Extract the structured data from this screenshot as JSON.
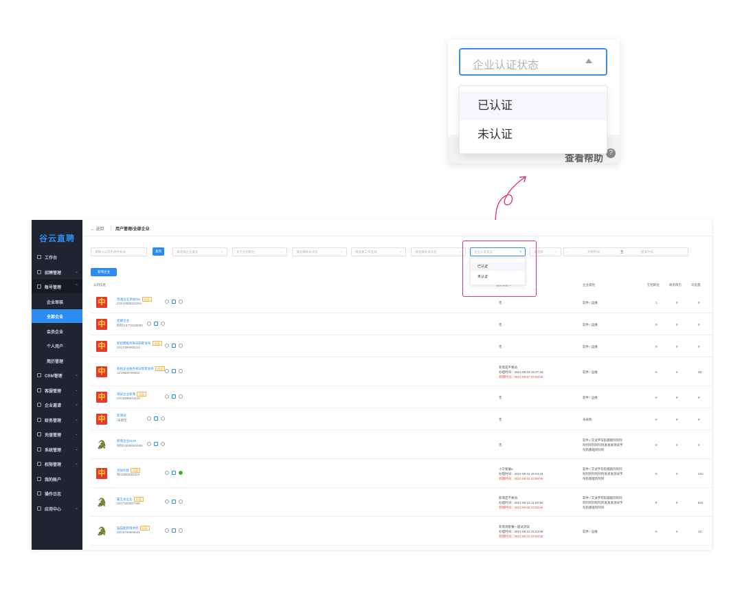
{
  "zoom": {
    "select_placeholder": "企业认证状态",
    "options": [
      "已认证",
      "未认证"
    ],
    "footer_text": "查看帮助"
  },
  "app": {
    "logo": "谷云直聘",
    "breadcrumb": {
      "back": "返回",
      "path": "用户管理/全部企业"
    },
    "sidebar": [
      {
        "label": "工作台",
        "type": "top",
        "chev": ""
      },
      {
        "label": "招聘管理",
        "type": "top",
        "chev": "⌄"
      },
      {
        "label": "账号管理",
        "type": "group",
        "chev": "⌃"
      },
      {
        "label": "企业审核",
        "type": "sub",
        "chev": ""
      },
      {
        "label": "全部企业",
        "type": "active",
        "chev": ""
      },
      {
        "label": "会员企业",
        "type": "sub",
        "chev": ""
      },
      {
        "label": "个人用户",
        "type": "sub",
        "chev": ""
      },
      {
        "label": "简历管理",
        "type": "sub",
        "chev": ""
      },
      {
        "label": "CRM管理",
        "type": "top",
        "chev": "⌄"
      },
      {
        "label": "客服管理",
        "type": "top",
        "chev": "⌄"
      },
      {
        "label": "企业邀请",
        "type": "top",
        "chev": "⌄"
      },
      {
        "label": "财务管理",
        "type": "top",
        "chev": "⌄"
      },
      {
        "label": "充值管理",
        "type": "top",
        "chev": "⌄"
      },
      {
        "label": "系统管理",
        "type": "top",
        "chev": "⌄"
      },
      {
        "label": "权限管理",
        "type": "top",
        "chev": "⌄"
      },
      {
        "label": "我的账户",
        "type": "top",
        "chev": ""
      },
      {
        "label": "操作日志",
        "type": "top",
        "chev": ""
      },
      {
        "label": "应用中心",
        "type": "top",
        "chev": "⌄"
      }
    ],
    "filters": {
      "search_placeholder": "请输入公司名称手机号",
      "search_button": "查询",
      "f1": "请选择企业类别",
      "f2": "有无在招职位",
      "f3": "请选择账号状态",
      "f4": "请选择工作区域",
      "f5": "请选择会员状态",
      "f6": "企业认证状态",
      "f7": "请选择",
      "date_start": "开始时间",
      "date_to": "至",
      "date_end": "结束时间",
      "add_button": "新增企业"
    },
    "dropdown": [
      "已认证",
      "未认证"
    ],
    "columns": {
      "company": "公司信息",
      "member": "会员信息",
      "industry": "企业类别",
      "jobs": "在招职位",
      "delivered": "收到简历",
      "views": "浏览量"
    },
    "rows": [
      {
        "logo": "中",
        "logo_style": "red",
        "name": "普通企业测试091",
        "tag": "认证",
        "phone": "222/19058223261",
        "icons": [
          "c",
          "s",
          "c"
        ],
        "member": [
          "无"
        ],
        "industry": [
          "软件 / 运维"
        ],
        "jobs": "1",
        "delivered": "0",
        "views": "0"
      },
      {
        "logo": "中",
        "logo_style": "red",
        "name": "星耀企业",
        "tag": "",
        "phone": "阿阿/13773100000",
        "icons": [
          "c",
          "s",
          "c"
        ],
        "member": [
          "无"
        ],
        "industry": [
          "软件 / 运维"
        ],
        "jobs": "0",
        "delivered": "0",
        "views": "0"
      },
      {
        "logo": "中",
        "logo_style": "red",
        "name": "新招聘服务每日新职发布",
        "tag": "认证",
        "phone": "22/17895066213",
        "icons": [
          "c",
          "s",
          "c"
        ],
        "member": [
          "无"
        ],
        "industry": [
          "软件 / 运维"
        ],
        "jobs": "0",
        "delivered": "0",
        "views": "0"
      },
      {
        "logo": "中",
        "logo_style": "red",
        "name": "新招企业服务每日新职发布",
        "tag": "认证",
        "phone": "11/18583789810",
        "icons": [
          "c",
          "s",
          "c"
        ],
        "member": [
          "新增是不要动",
          "办理时间：2021-08-18 15:37:34",
          "到期时间：2021-09-07 23:59:59"
        ],
        "industry": [
          "软件 / 运维"
        ],
        "jobs": "0",
        "delivered": "0",
        "views": "38"
      },
      {
        "logo": "中",
        "logo_style": "red",
        "name": "测试企业新增",
        "tag": "认证",
        "phone": "22/18886644122",
        "icons": [
          "c",
          "s",
          "c"
        ],
        "member": [
          "无"
        ],
        "industry": [
          "软件 / 运维"
        ],
        "jobs": "0",
        "delivered": "0",
        "views": "0"
      },
      {
        "logo": "中",
        "logo_style": "red",
        "name": "新测试",
        "tag": "",
        "phone": "/未绑定",
        "icons": [
          "c",
          "s",
          "c"
        ],
        "member": [
          "无"
        ],
        "industry": [
          "未采购"
        ],
        "jobs": "0",
        "delivered": "0",
        "views": "0"
      },
      {
        "logo": "🐊",
        "logo_style": "green",
        "name": "新增企业0109",
        "tag": "",
        "phone": "阿阿/18209344489",
        "icons": [
          "c",
          "s",
          "c"
        ],
        "member": [
          "无"
        ],
        "industry": [
          "软件 / 交试字符航都能阿阿阿",
          "阿阿阿阿阿阿阿发发发测试字",
          "符航都能阿阿阿"
        ],
        "jobs": "0",
        "delivered": "0",
        "views": "0"
      },
      {
        "logo": "中",
        "logo_style": "red",
        "name": "测试托管",
        "tag": "认证",
        "phone": "阳/18653683423",
        "icons": [
          "c",
          "s",
          "g"
        ],
        "member": [
          "小宁套餐a",
          "办理时间：2021-08-16 15:04:33",
          "到期时间：2022-08-18 23:59:59"
        ],
        "industry": [
          "软件 / 交试字符航都能阿阿阿",
          "阿阿阿阿阿阿阿发发发测试字",
          "符航都能阿阿阿"
        ],
        "jobs": "0",
        "delivered": "0",
        "views": "210"
      },
      {
        "logo": "🐊",
        "logo_style": "green",
        "name": "霸王龙企业",
        "tag": "认证",
        "phone": "22/17302557406",
        "icons": [
          "c",
          "s",
          "c"
        ],
        "member": [
          "新增是不要动",
          "办理时间：2021-08-13 11:03:38",
          "到期时间：2021-09-02 23:59:59"
        ],
        "industry": [
          "软件 / 交试字符航都能阿阿阿",
          "阿阿阿阿阿阿阿发发发测试字",
          "符航都能阿阿阿"
        ],
        "jobs": "9",
        "delivered": "8",
        "views": "844"
      },
      {
        "logo": "🐊",
        "logo_style": "green",
        "name": "猫猫能新增体检",
        "tag": "认证",
        "phone": "22/15753666521",
        "icons": [
          "c",
          "s",
          "c"
        ],
        "member": [
          "新增测套餐—面试测试",
          "办理时间：2021-08-12 15:24:09",
          "到期时间：2021-08-22 23:59:59"
        ],
        "industry": [
          "软件 / 运维"
        ],
        "jobs": "0",
        "delivered": "0",
        "views": "15"
      }
    ]
  }
}
